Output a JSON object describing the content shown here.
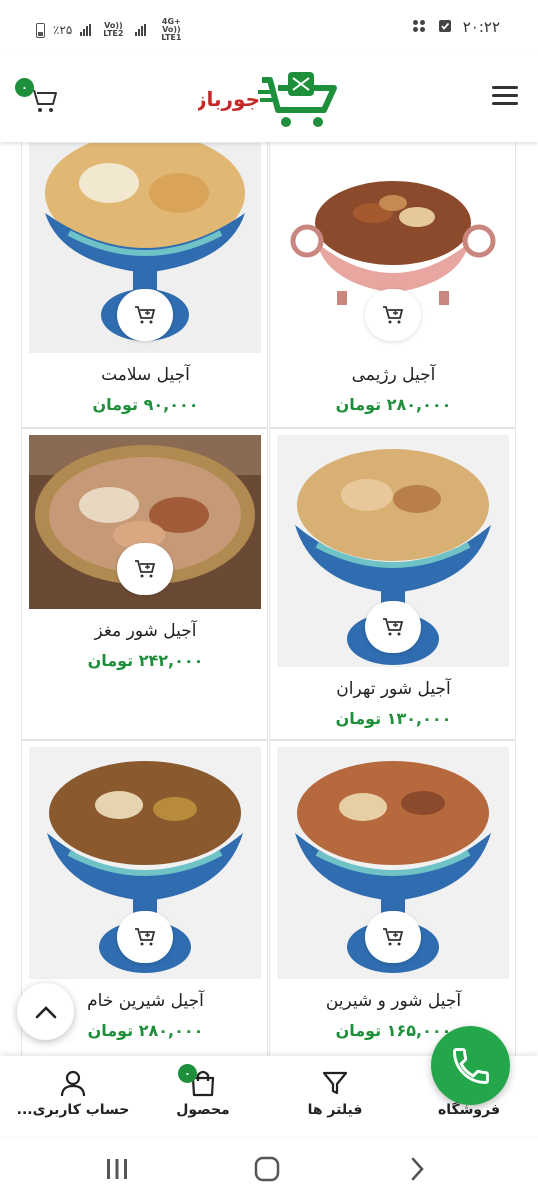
{
  "status_bar": {
    "time": "۲۰:۲۲",
    "battery": "٪۲۵",
    "network_1": "Vo)) LTE2",
    "network_2": "4G+ Vo)) LTE1"
  },
  "header": {
    "logo_text": "جوربازار",
    "cart_count": "۰"
  },
  "products": [
    {
      "name": "آجیل رژیمی",
      "price": "۲۸۰,۰۰۰ تومان"
    },
    {
      "name": "آجیل سلامت",
      "price": "۹۰,۰۰۰ تومان"
    },
    {
      "name": "آجیل شور تهران",
      "price": "۱۳۰,۰۰۰ تومان"
    },
    {
      "name": "آجیل شور مغز",
      "price": "۲۴۲,۰۰۰ تومان"
    },
    {
      "name": "آجیل شور و شیرین",
      "price": "۱۶۵,۰۰۰ تومان"
    },
    {
      "name": "آجیل شیرین خام",
      "price": "۲۸۰,۰۰۰ تومان"
    }
  ],
  "bottom_nav": {
    "shop": "فروشگاه",
    "filters": "فیلتر ها",
    "product": "محصول",
    "product_count": "۰",
    "account": "حساب کاربری..."
  },
  "colors": {
    "accent_green": "#1e8f3a",
    "fab_green": "#24a64b"
  },
  "icons": [
    "menu-icon",
    "cart-icon",
    "add-to-cart-icon",
    "chevron-up-icon",
    "phone-icon",
    "store-icon",
    "filter-icon",
    "bag-icon",
    "user-icon"
  ]
}
